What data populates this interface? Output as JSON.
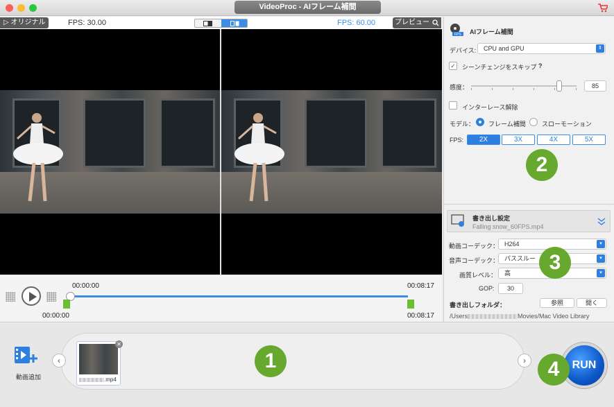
{
  "window": {
    "title": "VideoProc - AIフレーム補間"
  },
  "preview": {
    "original_label": "▷ オリジナル",
    "fps_left": "FPS: 30.00",
    "fps_right": "FPS: 60.00",
    "preview_label": "プレビュー"
  },
  "timeline": {
    "time_start_top": "00:00:00",
    "time_end_top": "00:08:17",
    "time_start_bottom": "00:00:00",
    "time_end_bottom": "00:08:17",
    "position_fraction": 0
  },
  "ai_panel": {
    "title": "AIフレーム補間",
    "device_label": "デバイス:",
    "device_value": "CPU and GPU",
    "scene_skip_label": "シーンチェンジをスキップ",
    "help": "?",
    "sensitivity_label": "感度：",
    "sensitivity_value": "85",
    "deinterlace_label": "インターレース解除",
    "mode_label": "モデル：",
    "mode_frame": "フレーム補間",
    "mode_slow": "スローモーション",
    "fps_label": "FPS:",
    "fps_options": [
      "2X",
      "3X",
      "4X",
      "5X"
    ],
    "fps_selected": "2X"
  },
  "export": {
    "title": "書き出し設定",
    "filename": "Falling snow_60FPS.mp4",
    "video_codec_label": "動画コーデック：",
    "video_codec": "H264",
    "audio_codec_label": "音声コーデック：",
    "audio_codec": "パススルー",
    "quality_label": "画質レベル：",
    "quality": "高",
    "gop_label": "GOP:",
    "gop": "30",
    "folder_label": "書き出しフォルダ：",
    "browse": "参照",
    "open": "開く",
    "path_start": "/Users",
    "path_end": "Movies/Mac Video Library"
  },
  "bottom": {
    "add_video_label": "動画追加",
    "thumb_name": ".mp4",
    "run_label": "RUN"
  },
  "badges": [
    "1",
    "2",
    "3",
    "4"
  ],
  "colors": {
    "accent": "#2f7fe0",
    "badge": "#67a82f",
    "video_bg": "#000000"
  }
}
